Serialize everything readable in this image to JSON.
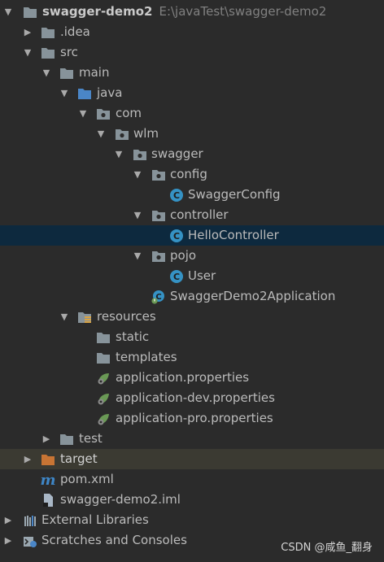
{
  "tree": {
    "project": {
      "name": "swagger-demo2",
      "path": "E:\\javaTest\\swagger-demo2"
    },
    "idea": ".idea",
    "src": "src",
    "main": "main",
    "java": "java",
    "com": "com",
    "wlm": "wlm",
    "swagger": "swagger",
    "config": "config",
    "swagger_config": "SwaggerConfig",
    "controller": "controller",
    "hello_controller": "HelloController",
    "pojo": "pojo",
    "user": "User",
    "app": "SwaggerDemo2Application",
    "resources": "resources",
    "static": "static",
    "templates": "templates",
    "app_props": "application.properties",
    "app_dev_props": "application-dev.properties",
    "app_pro_props": "application-pro.properties",
    "test": "test",
    "target": "target",
    "pom": "pom.xml",
    "iml": "swagger-demo2.iml",
    "ext_libs": "External Libraries",
    "scratches": "Scratches and Consoles"
  },
  "watermark": "CSDN @咸鱼_翻身",
  "colors": {
    "background": "#2b2b2b",
    "selected_row": "#0d293e",
    "excluded_row": "#3b3a32",
    "folder": "#87939a",
    "source_folder": "#4a86c7",
    "excluded_folder": "#c77434",
    "class_icon": "#3592c4",
    "spring_green": "#6a9955"
  },
  "icons": {
    "folder": "folder-icon",
    "package": "package-icon",
    "class": "class-icon",
    "spring_boot_app": "spring-boot-app-icon",
    "spring_properties": "spring-properties-icon",
    "maven": "maven-icon",
    "iml": "iml-file-icon",
    "libraries": "libraries-icon",
    "scratches": "scratches-icon"
  }
}
